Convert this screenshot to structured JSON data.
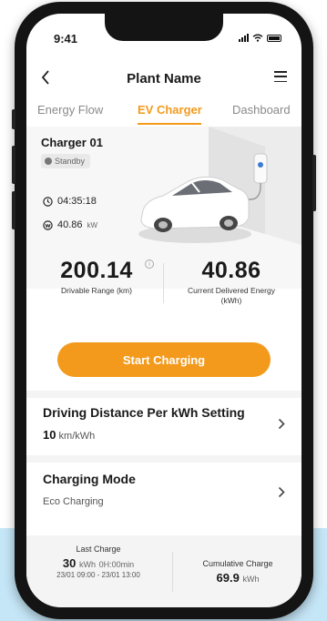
{
  "status": {
    "time": "9:41"
  },
  "header": {
    "title": "Plant Name",
    "back_icon": "chevron-left-icon",
    "menu_icon": "menu-icon"
  },
  "tabs": [
    {
      "label": "Energy Flow",
      "active": false
    },
    {
      "label": "EV Charger",
      "active": true
    },
    {
      "label": "Dashboard",
      "active": false
    }
  ],
  "charger": {
    "name": "Charger 01",
    "status": "Standby",
    "duration": "04:35:18",
    "power_value": "40.86",
    "power_unit": "kW"
  },
  "metrics": {
    "range_value": "200.14",
    "range_label": "Drivable Range  (km)",
    "energy_value": "40.86",
    "energy_label_line1": "Current Delivered Energy",
    "energy_label_line2": "(kWh)"
  },
  "actions": {
    "start_label": "Start Charging"
  },
  "settings": {
    "distance_title": "Driving Distance Per kWh Setting",
    "distance_value": "10",
    "distance_unit": "km/kWh",
    "mode_title": "Charging Mode",
    "mode_value": "Eco Charging"
  },
  "summary": {
    "last_label": "Last Charge",
    "last_value": "30",
    "last_unit": "kWh",
    "last_duration": "0H:00min",
    "last_range": "23/01 09:00  -  23/01 13:00",
    "cumulative_label": "Cumulative Charge",
    "cumulative_value": "69.9",
    "cumulative_unit": "kWh"
  },
  "colors": {
    "accent": "#f39a1c",
    "background_band": "#c5e6f7"
  }
}
